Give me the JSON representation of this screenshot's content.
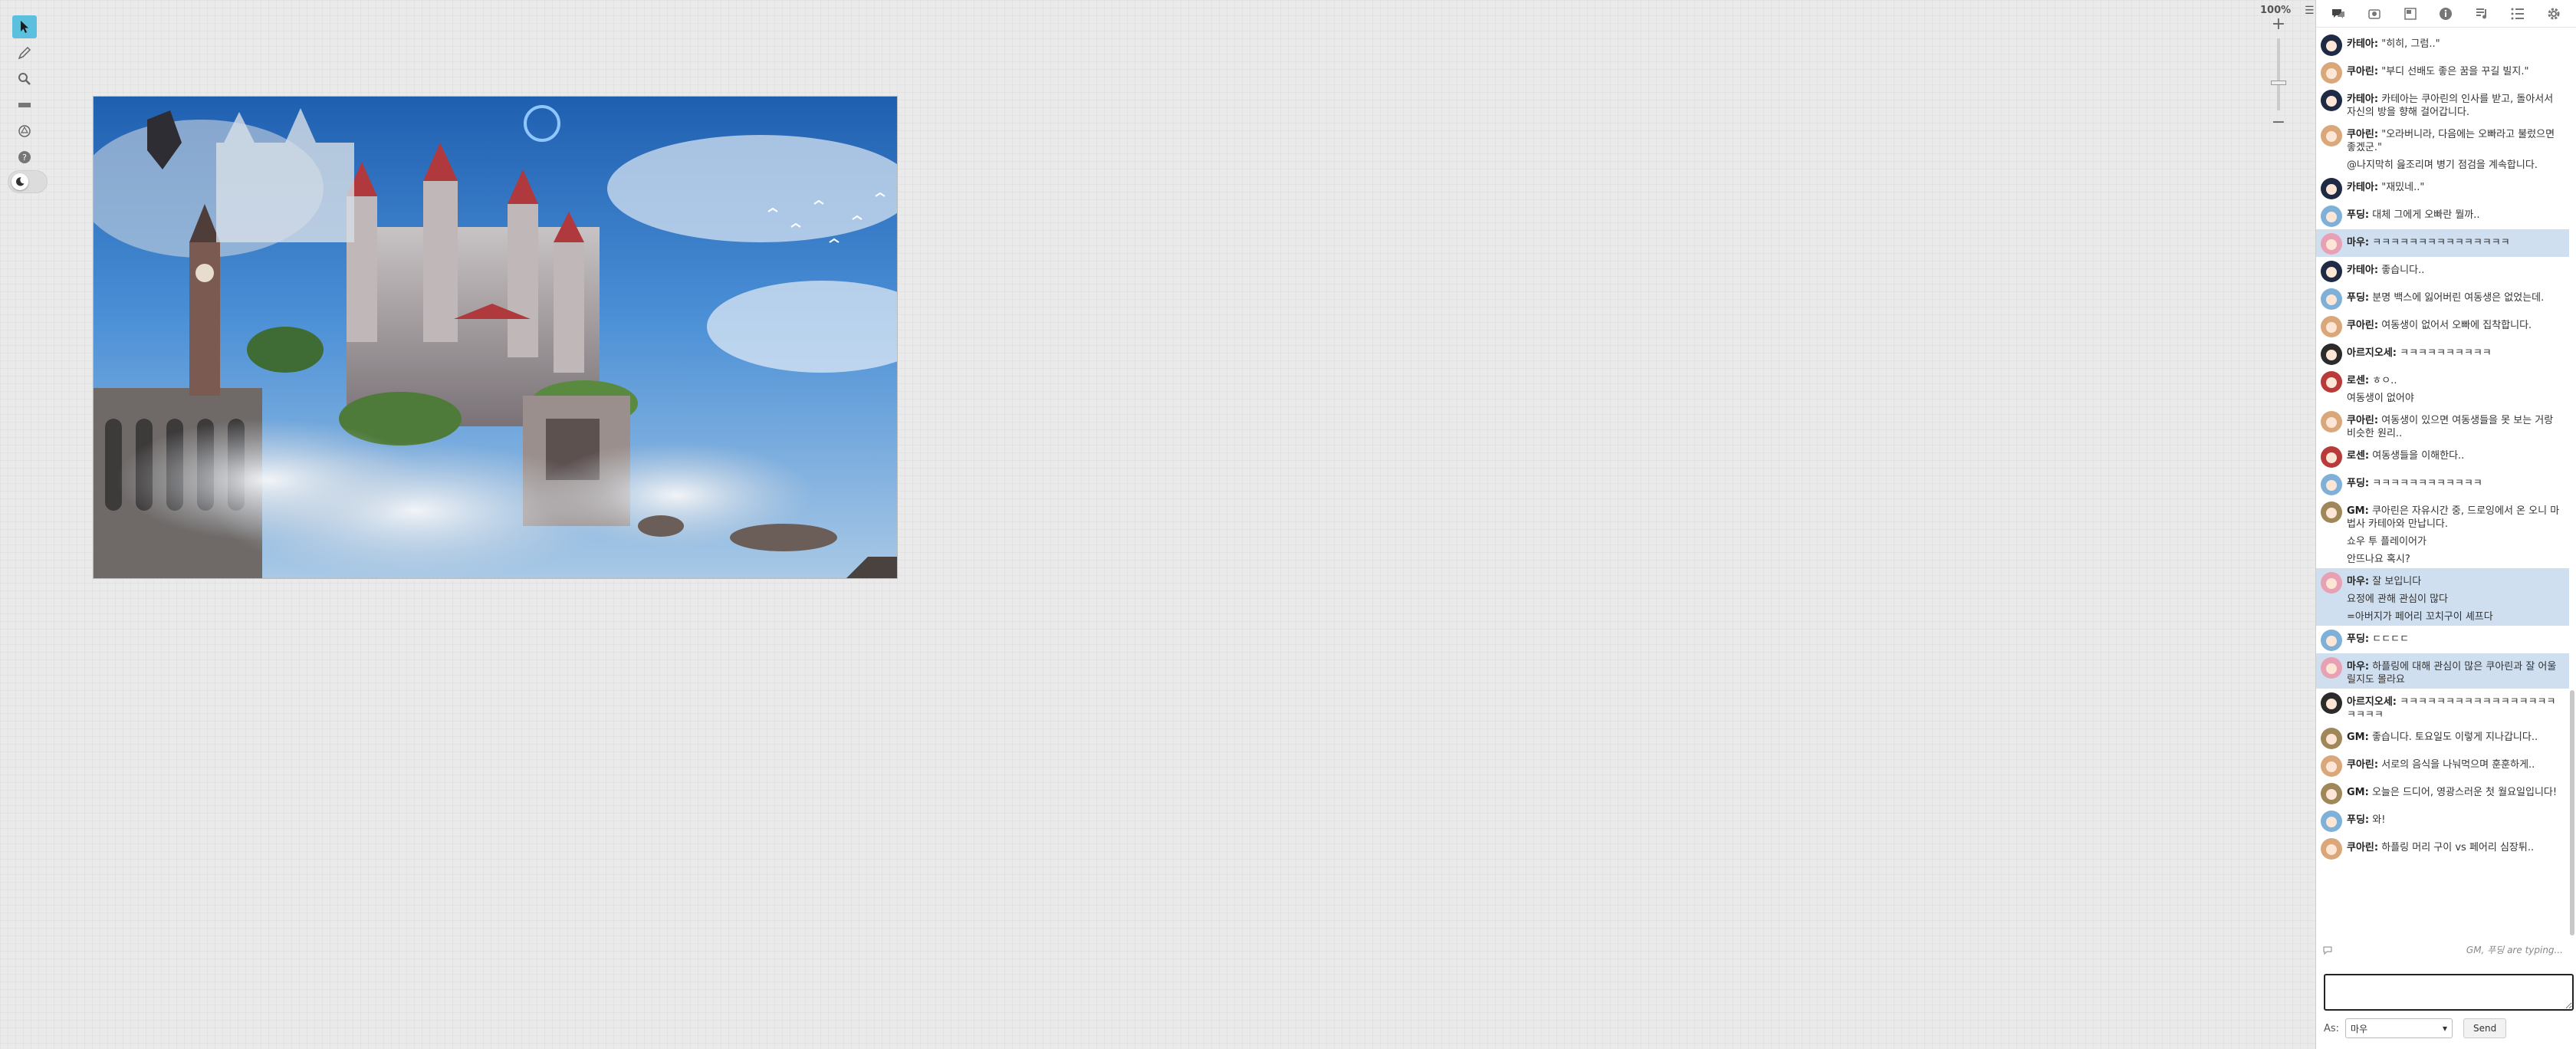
{
  "toolbar": {
    "tools": [
      {
        "name": "select-tool",
        "icon": "cursor-icon"
      },
      {
        "name": "draw-tool",
        "icon": "pencil-icon"
      },
      {
        "name": "zoom-tool",
        "icon": "magnifier-icon"
      },
      {
        "name": "measure-tool",
        "icon": "ruler-icon"
      },
      {
        "name": "dice-tool",
        "icon": "dice-icon"
      },
      {
        "name": "help-tool",
        "icon": "question-icon"
      }
    ],
    "accent": "#5bc0de"
  },
  "zoom": {
    "label": "100%",
    "level": 1.0
  },
  "sidebar": {
    "tabs": [
      "chat-icon",
      "art-library-icon",
      "journal-icon",
      "info-icon",
      "jukebox-icon",
      "collection-icon",
      "settings-icon"
    ],
    "messages": [
      {
        "who": "카테아:",
        "text": "\"히히, 그럼..\"",
        "avatar": "#1f2a44",
        "you": false
      },
      {
        "who": "쿠아린:",
        "text": "\"부디 선배도 좋은 꿈을 꾸길 빌지.\"",
        "avatar": "#d9a77a",
        "you": false
      },
      {
        "who": "카테아:",
        "text": "카테아는 쿠아린의 인사를 받고, 돌아서서 자신의 방을 향해 걸어갑니다.",
        "avatar": "#1f2a44",
        "you": false
      },
      {
        "who": "쿠아린:",
        "text": "\"오라버니라, 다음에는 오빠라고 불렀으면 좋겠군.\"",
        "cont": "@나지막히 읊조리며 병기 점검을 계속합니다.",
        "avatar": "#d9a77a",
        "you": false
      },
      {
        "who": "카테아:",
        "text": "\"재밌네..\"",
        "avatar": "#1f2a44",
        "you": false
      },
      {
        "who": "푸딩:",
        "text": "대체 그에게 오빠란 뭘까..",
        "avatar": "#7fb0d8",
        "you": false
      },
      {
        "who": "마우:",
        "text": "ㅋㅋㅋㅋㅋㅋㅋㅋㅋㅋㅋㅋㅋㅋㅋ",
        "avatar": "#e8a0b4",
        "you": true
      },
      {
        "who": "카테아:",
        "text": "좋습니다..",
        "avatar": "#1f2a44",
        "you": false
      },
      {
        "who": "푸딩:",
        "text": "분명 백스에 잃어버린 여동생은 없었는데.",
        "avatar": "#7fb0d8",
        "you": false
      },
      {
        "who": "쿠아린:",
        "text": "여동생이 없어서 오빠에 집착합니다.",
        "avatar": "#d9a77a",
        "you": false
      },
      {
        "who": "아르지오세:",
        "text": "ㅋㅋㅋㅋㅋㅋㅋㅋㅋㅋ",
        "avatar": "#2b2b2b",
        "you": false
      },
      {
        "who": "로센:",
        "text": "ㅎㅇ..",
        "cont": "여동생이 없어야",
        "avatar": "#b83a3a",
        "you": false
      },
      {
        "who": "쿠아린:",
        "text": "여동생이 있으면 여동생들을 못 보는 거랑 비슷한 원리..",
        "avatar": "#d9a77a",
        "you": false
      },
      {
        "who": "로센:",
        "text": "여동생들을 이해한다..",
        "avatar": "#b83a3a",
        "you": false
      },
      {
        "who": "푸딩:",
        "text": "ㅋㅋㅋㅋㅋㅋㅋㅋㅋㅋㅋㅋ",
        "avatar": "#7fb0d8",
        "you": false
      },
      {
        "who": "GM:",
        "text": "쿠아린은 자유시간 중, 드로잉에서 온 오니 마법사 카테아와 만납니다.",
        "cont": "쇼우 투 플레이어가",
        "cont2": "안뜨나요 혹시?",
        "avatar": "#a0875a",
        "you": false
      },
      {
        "who": "마우:",
        "text": "잘 보입니다",
        "cont": "요정에 관해 관심이 많다",
        "cont2": "=아버지가 페어리 꼬치구이 셰프다",
        "avatar": "#e8a0b4",
        "you": true
      },
      {
        "who": "푸딩:",
        "text": "ㄷㄷㄷㄷ",
        "avatar": "#7fb0d8",
        "you": false
      },
      {
        "who": "마우:",
        "text": "하플링에 대해 관심이 많은 쿠아린과 잘 어울릴지도 몰라요",
        "avatar": "#e8a0b4",
        "you": true
      },
      {
        "who": "아르지오세:",
        "text": "ㅋㅋㅋㅋㅋㅋㅋㅋㅋㅋㅋㅋㅋㅋㅋㅋㅋㅋㅋㅋㅋ",
        "avatar": "#2b2b2b",
        "you": false
      },
      {
        "who": "GM:",
        "text": "좋습니다. 토요일도 이렇게 지나갑니다..",
        "avatar": "#a0875a",
        "you": false
      },
      {
        "who": "쿠아린:",
        "text": "서로의 음식을 나눠먹으며 훈훈하게..",
        "avatar": "#d9a77a",
        "you": false
      },
      {
        "who": "GM:",
        "text": "오늘은 드디어, 영광스러운 첫 월요일입니다!",
        "avatar": "#a0875a",
        "you": false
      },
      {
        "who": "푸딩:",
        "text": "와!",
        "avatar": "#7fb0d8",
        "you": false
      },
      {
        "who": "쿠아린:",
        "text": "하플링 머리 구이 vs 페어리 심장튀..",
        "avatar": "#d9a77a",
        "you": false
      }
    ],
    "typing": "GM, 푸딩 are typing...",
    "input_value": "",
    "as_label": "As:",
    "as_value": "마우",
    "send_label": "Send"
  }
}
